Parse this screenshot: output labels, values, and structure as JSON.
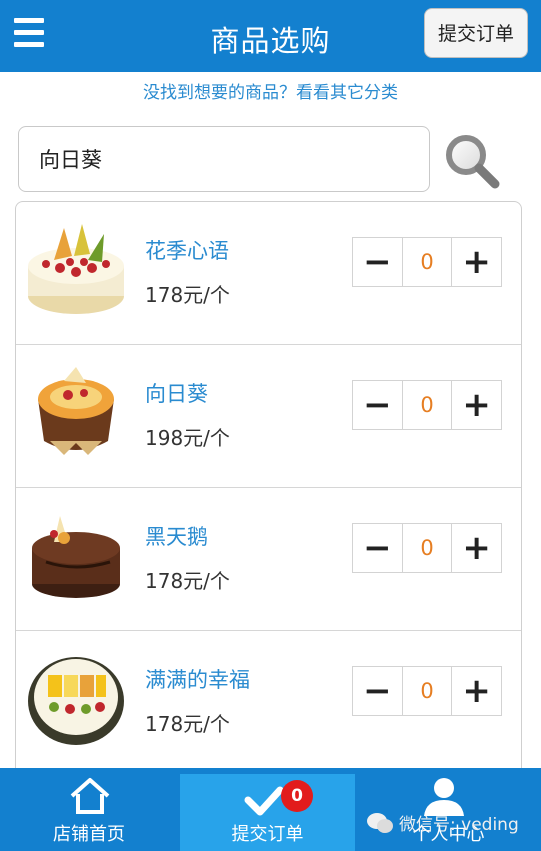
{
  "header": {
    "title": "商品选购",
    "submit_label": "提交订单",
    "menu_icon": "hamburger-icon"
  },
  "hint": "没找到想要的商品？看看其它分类",
  "search": {
    "value": "向日葵",
    "icon": "search-icon"
  },
  "products": [
    {
      "name": "花季心语",
      "price": "178元/个",
      "qty": "0",
      "minus": "−",
      "plus": "+"
    },
    {
      "name": "向日葵",
      "price": "198元/个",
      "qty": "0",
      "minus": "−",
      "plus": "+"
    },
    {
      "name": "黑天鹅",
      "price": "178元/个",
      "qty": "0",
      "minus": "−",
      "plus": "+"
    },
    {
      "name": "满满的幸福",
      "price": "178元/个",
      "qty": "0",
      "minus": "−",
      "plus": "+"
    }
  ],
  "tabs": [
    {
      "label": "店铺首页",
      "icon": "home-icon"
    },
    {
      "label": "提交订单",
      "icon": "check-icon",
      "badge": "0"
    },
    {
      "label": "个人中心",
      "icon": "user-icon"
    }
  ],
  "watermark": "微信号: veding",
  "colors": {
    "primary": "#1380cf",
    "active_tab": "#28a3ea",
    "link": "#2a8bd0",
    "qty": "#e67e22",
    "badge": "#e21c1c"
  }
}
